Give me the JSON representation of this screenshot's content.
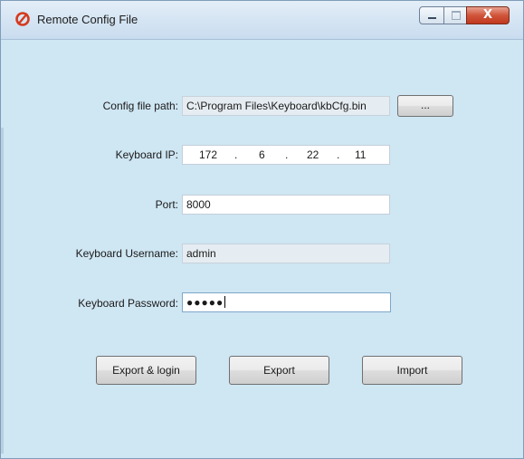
{
  "window": {
    "title": "Remote Config File",
    "controls": {
      "minimize_icon": "minimize-icon",
      "maximize_icon": "maximize-icon",
      "close_label": "X"
    }
  },
  "form": {
    "config_path": {
      "label": "Config file path:",
      "value": "C:\\Program Files\\Keyboard\\kbCfg.bin",
      "browse_label": "..."
    },
    "ip": {
      "label": "Keyboard IP:",
      "octets": [
        "172",
        "6",
        "22",
        "11"
      ],
      "separator": "."
    },
    "port": {
      "label": "Port:",
      "value": "8000"
    },
    "username": {
      "label": "Keyboard Username:",
      "value": "admin"
    },
    "password": {
      "label": "Keyboard Password:",
      "masked_value": "●●●●●"
    }
  },
  "actions": {
    "export_login": "Export & login",
    "export": "Export",
    "import": "Import"
  },
  "colors": {
    "window_bg": "#cfe6f3",
    "close_button": "#c9432a",
    "app_icon": "#d63a1f"
  }
}
